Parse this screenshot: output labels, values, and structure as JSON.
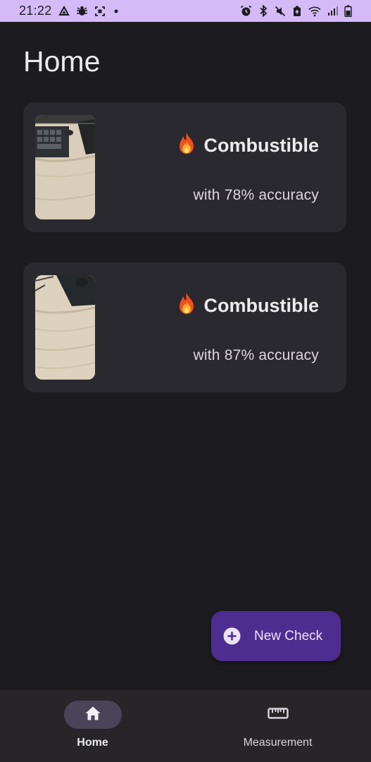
{
  "status_bar": {
    "time": "21:22",
    "left_icons": [
      "drive-icon",
      "bug-icon",
      "screenshot-icon",
      "dot-icon"
    ],
    "right_icons": [
      "alarm-icon",
      "bluetooth-icon",
      "mute-icon",
      "battery-saver-icon",
      "wifi-icon",
      "signal-icon",
      "battery-icon"
    ]
  },
  "page": {
    "title": "Home"
  },
  "checks": [
    {
      "icon": "fire-icon",
      "result": "Combustible",
      "accuracy_text": "with 78% accuracy",
      "accuracy": 78
    },
    {
      "icon": "fire-icon",
      "result": "Combustible",
      "accuracy_text": "with 87% accuracy",
      "accuracy": 87
    }
  ],
  "fab": {
    "icon": "plus-circle-icon",
    "label": "New Check"
  },
  "bottom_nav": {
    "items": [
      {
        "label": "Home",
        "icon": "home-icon",
        "active": true
      },
      {
        "label": "Measurement",
        "icon": "ruler-icon",
        "active": false
      }
    ]
  },
  "colors": {
    "background": "#1c1b1f",
    "status_bar": "#d4bbf8",
    "card": "#2b2930",
    "fab": "#4e2d91",
    "nav_bar": "#27252a",
    "nav_active_pill": "#4a4458"
  }
}
